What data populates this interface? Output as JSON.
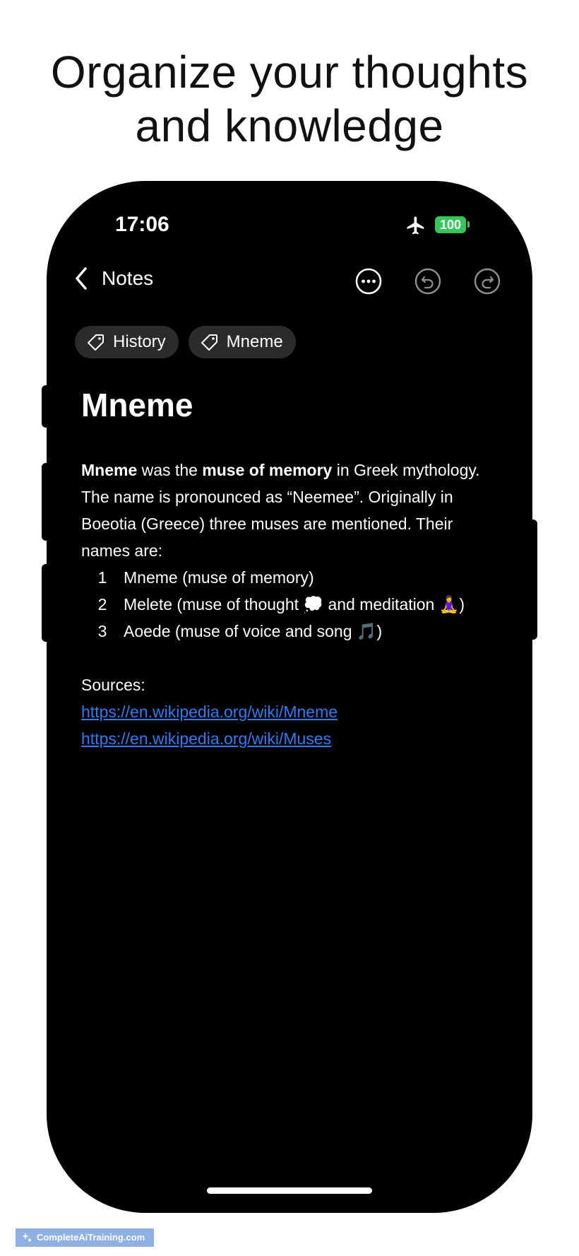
{
  "headline": {
    "line1": "Organize your thoughts",
    "line2": "and knowledge"
  },
  "status_bar": {
    "time": "17:06",
    "battery": "100",
    "airplane_icon": "airplane-icon"
  },
  "nav": {
    "back_label": "Notes",
    "icons": [
      "chevron-left-icon",
      "more-icon",
      "undo-icon",
      "redo-icon"
    ]
  },
  "tags": [
    {
      "label": "History",
      "icon": "tag-icon"
    },
    {
      "label": "Mneme",
      "icon": "tag-icon"
    }
  ],
  "note": {
    "title": "Mneme",
    "intro": {
      "bold1": "Mneme",
      "text1": " was the ",
      "bold2": "muse of memory",
      "text2": " in Greek mythology. The name is pronounced as “Neemee”. Originally in Boeotia (Greece) three muses are mentioned. Their names are:"
    },
    "list": [
      {
        "number": "1",
        "text": "Mneme (muse of memory)"
      },
      {
        "number": "2",
        "text": "Melete (muse of thought 💭 and meditation 🧘‍♀️)"
      },
      {
        "number": "3",
        "text": "Aoede (muse of voice and song 🎵)"
      }
    ],
    "sources_label": "Sources:",
    "links": [
      "https://en.wikipedia.org/wiki/Mneme",
      "https://en.wikipedia.org/wiki/Muses"
    ]
  },
  "watermark": "CompleteAiTraining.com",
  "colors": {
    "link": "#2f7bf5",
    "battery": "#34c759",
    "tag_bg": "#2b2b2d",
    "background": "#000000"
  }
}
